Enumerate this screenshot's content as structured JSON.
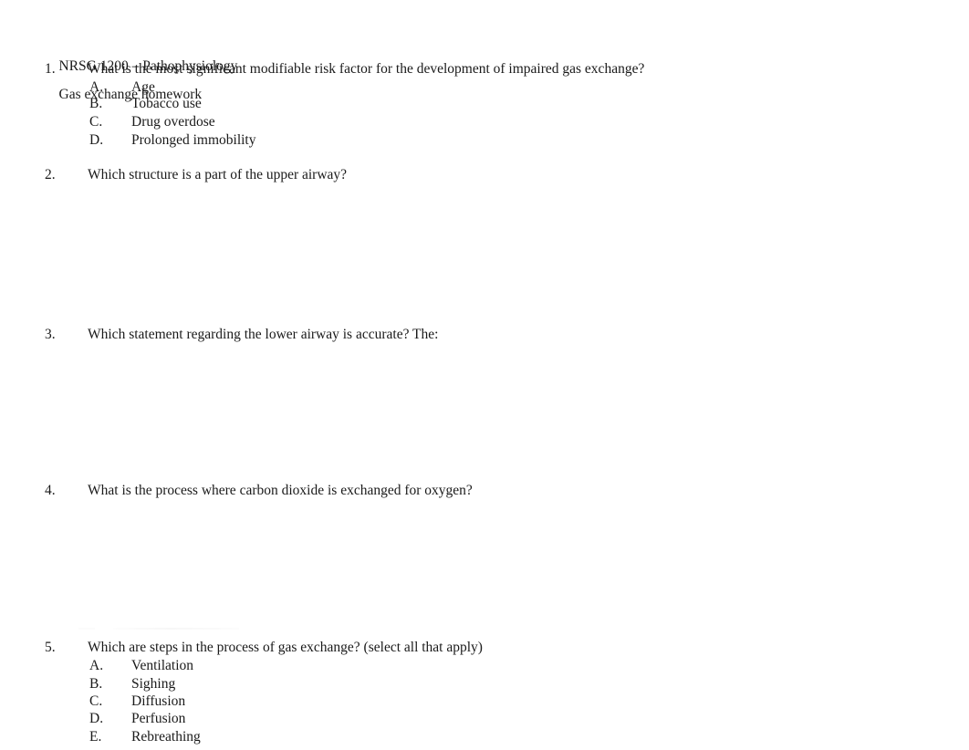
{
  "document": {
    "header": {
      "course": "NRSG 1200 – Pathophysiology",
      "title": "Gas exchange homework"
    },
    "questions": [
      {
        "number": "1.",
        "stem": "What is the most significant modifiable risk factor for the development of impaired gas exchange?",
        "options": [
          {
            "letter": "A.",
            "text": "Age"
          },
          {
            "letter": "B.",
            "text": "Tobacco use"
          },
          {
            "letter": "C.",
            "text": "Drug overdose"
          },
          {
            "letter": "D.",
            "text": "Prolonged immobility"
          }
        ]
      },
      {
        "number": "2.",
        "stem": "Which structure is a part of the upper airway?",
        "options": []
      },
      {
        "number": "3.",
        "stem": "Which statement regarding the lower airway is accurate? The:",
        "options": []
      },
      {
        "number": "4.",
        "stem": "What is the process where carbon dioxide is exchanged for oxygen?",
        "options": []
      },
      {
        "number": "5.",
        "stem": "Which are steps in the process of gas exchange? (select all that apply)",
        "options": [
          {
            "letter": "A.",
            "text": "Ventilation"
          },
          {
            "letter": "B.",
            "text": "Sighing"
          },
          {
            "letter": "C.",
            "text": "Diffusion"
          },
          {
            "letter": "D.",
            "text": "Perfusion"
          },
          {
            "letter": "E.",
            "text": "Rebreathing"
          }
        ]
      }
    ]
  },
  "layout": {
    "question_tops": [
      68,
      184,
      359,
      530,
      702
    ],
    "option_tops": [
      [
        88,
        106,
        126,
        146
      ],
      [],
      [],
      [],
      [
        722,
        742,
        761,
        780,
        800
      ]
    ]
  },
  "colors": {
    "page_background": "#ffffff",
    "text": "#1a1a1a"
  }
}
